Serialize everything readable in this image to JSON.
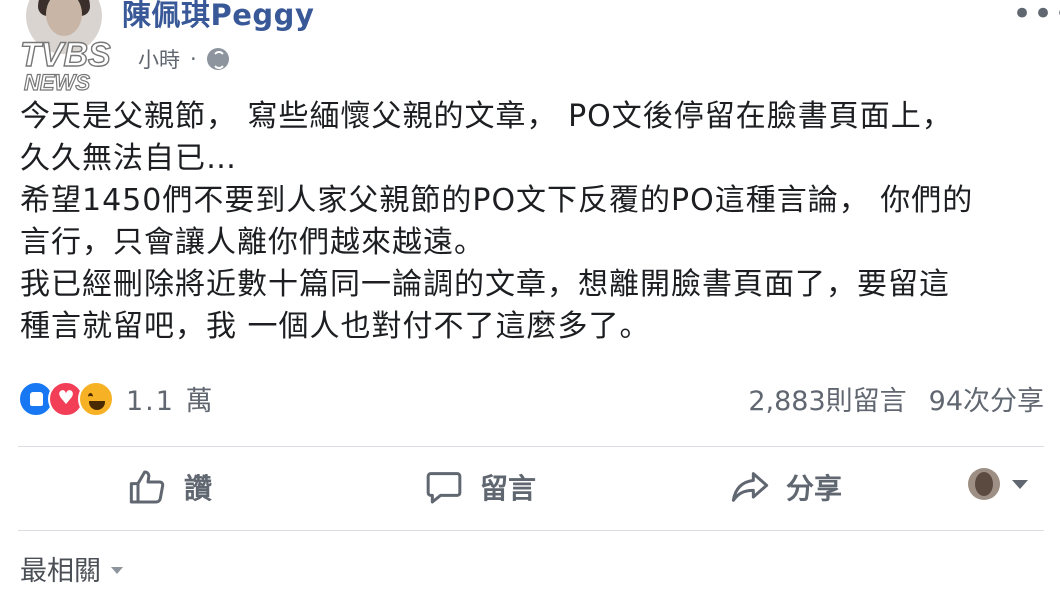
{
  "post": {
    "author": "陳佩琪Peggy",
    "time": "小時",
    "separator": "·",
    "privacy_icon": "globe-icon",
    "more_icon": "more-icon",
    "text_lines": [
      "今天是父親節， 寫些緬懷父親的文章， PO文後停留在臉書頁面上，",
      "久久無法自已…",
      "希望1450們不要到人家父親節的PO文下反覆的PO這種言論， 你們的",
      "言行，只會讓人離你們越來越遠。",
      "我已經刪除將近數十篇同一論調的文章，想離開臉書頁面了，要留這",
      "種言就留吧，我 一個人也對付不了這麼多了。"
    ]
  },
  "reactions": {
    "types": [
      "like",
      "love",
      "haha"
    ],
    "count": "1.1 萬",
    "comments": "2,883則留言",
    "shares": "94次分享"
  },
  "actions": {
    "like": "讚",
    "comment": "留言",
    "share": "分享"
  },
  "comments": {
    "sort_label": "最相關"
  },
  "watermark": {
    "brand": "TVBS",
    "sub": "NEWS"
  },
  "colors": {
    "author_link": "#385898",
    "like_blue": "#1877f2",
    "love_red": "#f33e58",
    "haha_yellow": "#f7b125",
    "secondary_text": "#616770"
  }
}
